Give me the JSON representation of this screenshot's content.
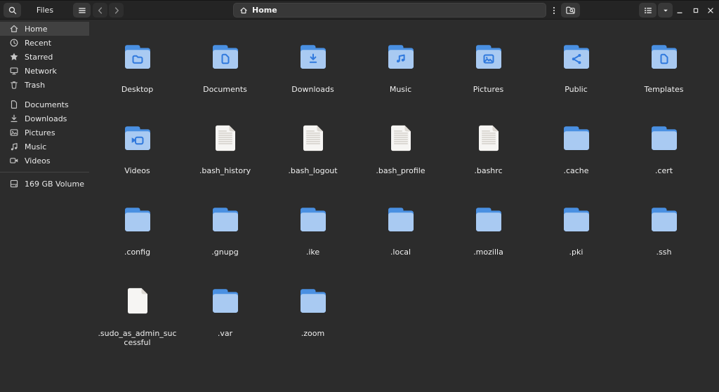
{
  "header": {
    "app_title": "Files",
    "location": "Home",
    "toolbar_icons": [
      "search-icon",
      "menu-icon",
      "back-icon",
      "forward-icon",
      "home-icon",
      "kebab-menu-icon",
      "folder-search-icon",
      "list-view-icon",
      "dropdown-icon",
      "minimize-icon",
      "maximize-icon",
      "close-icon"
    ]
  },
  "sidebar": {
    "items": [
      {
        "label": "Home",
        "icon": "home-icon",
        "selected": true
      },
      {
        "label": "Recent",
        "icon": "clock-icon"
      },
      {
        "label": "Starred",
        "icon": "star-icon"
      },
      {
        "label": "Network",
        "icon": "network-icon"
      },
      {
        "label": "Trash",
        "icon": "trash-icon"
      },
      {
        "label": "Documents",
        "icon": "document-icon",
        "group_start": true
      },
      {
        "label": "Downloads",
        "icon": "download-icon"
      },
      {
        "label": "Pictures",
        "icon": "picture-icon"
      },
      {
        "label": "Music",
        "icon": "music-icon"
      },
      {
        "label": "Videos",
        "icon": "video-icon"
      }
    ],
    "volume": {
      "label": "169 GB Volume",
      "icon": "disk-icon"
    }
  },
  "files": [
    {
      "name": "Desktop",
      "kind": "folder",
      "emblem": "folder"
    },
    {
      "name": "Documents",
      "kind": "folder",
      "emblem": "file"
    },
    {
      "name": "Downloads",
      "kind": "folder",
      "emblem": "download"
    },
    {
      "name": "Music",
      "kind": "folder",
      "emblem": "music"
    },
    {
      "name": "Pictures",
      "kind": "folder",
      "emblem": "picture"
    },
    {
      "name": "Public",
      "kind": "folder",
      "emblem": "share"
    },
    {
      "name": "Templates",
      "kind": "folder",
      "emblem": "file"
    },
    {
      "name": "Videos",
      "kind": "folder",
      "emblem": "video"
    },
    {
      "name": ".bash_history",
      "kind": "text-file"
    },
    {
      "name": ".bash_logout",
      "kind": "text-file"
    },
    {
      "name": ".bash_profile",
      "kind": "text-file"
    },
    {
      "name": ".bashrc",
      "kind": "text-file"
    },
    {
      "name": ".cache",
      "kind": "folder"
    },
    {
      "name": ".cert",
      "kind": "folder"
    },
    {
      "name": ".config",
      "kind": "folder"
    },
    {
      "name": ".gnupg",
      "kind": "folder"
    },
    {
      "name": ".ike",
      "kind": "folder"
    },
    {
      "name": ".local",
      "kind": "folder"
    },
    {
      "name": ".mozilla",
      "kind": "folder"
    },
    {
      "name": ".pki",
      "kind": "folder"
    },
    {
      "name": ".ssh",
      "kind": "folder"
    },
    {
      "name": ".sudo_as_admin_successful",
      "kind": "file"
    },
    {
      "name": ".var",
      "kind": "folder"
    },
    {
      "name": ".zoom",
      "kind": "folder"
    }
  ],
  "colors": {
    "folder_tab": "#4a90e2",
    "folder_body": "#a9caf2",
    "emblem": "#3079dd",
    "file_body": "#f6f5f3",
    "file_fold": "#dcd8d2",
    "file_lines": "#d8d5d0",
    "accent": "#3584e4"
  }
}
